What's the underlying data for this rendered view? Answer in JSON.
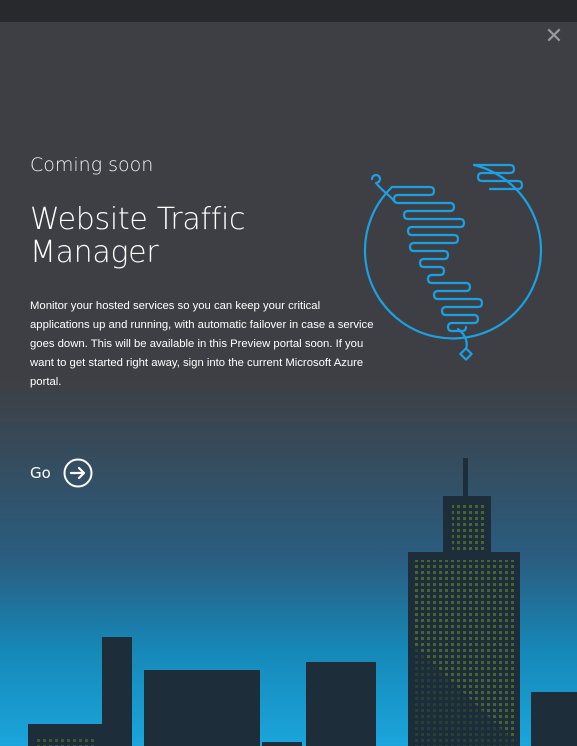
{
  "window": {
    "close_icon": "close-icon"
  },
  "content": {
    "kicker": "Coming soon",
    "title": "Website Traffic Manager",
    "description": "Monitor your hosted services so you can keep your critical applications up and running, with automatic failover in case a service goes down. This will be available in this Preview portal soon. If you want to get started right away, sign into the current Microsoft Azure portal.",
    "go_label": "Go",
    "go_icon": "arrow-right-circle-icon",
    "illustration_icon": "globe-americas-icon"
  },
  "colors": {
    "accent": "#1ba1e2",
    "background": "#3e3f44",
    "building": "#1d2d3a",
    "window_lights": "#4f6a2e"
  }
}
